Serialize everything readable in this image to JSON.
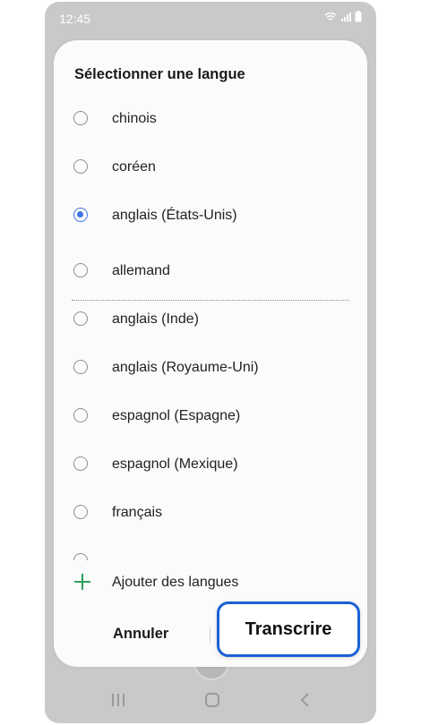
{
  "status_bar": {
    "time": "12:45"
  },
  "dialog": {
    "title": "Sélectionner une langue",
    "languages": [
      {
        "label": "chinois",
        "selected": false
      },
      {
        "label": "coréen",
        "selected": false
      },
      {
        "label": "anglais (États-Unis)",
        "selected": true
      },
      {
        "label": "allemand",
        "selected": false
      },
      {
        "label": "anglais (Inde)",
        "selected": false
      },
      {
        "label": "anglais (Royaume-Uni)",
        "selected": false
      },
      {
        "label": "espagnol (Espagne)",
        "selected": false
      },
      {
        "label": "espagnol (Mexique)",
        "selected": false
      },
      {
        "label": "français",
        "selected": false
      }
    ],
    "add_languages_label": "Ajouter des langues",
    "cancel_label": "Annuler",
    "transcribe_label": "Transcrire"
  },
  "icons": {
    "add": "plus-icon",
    "wifi": "wifi-icon",
    "signal": "signal-icon",
    "battery": "battery-icon"
  },
  "colors": {
    "accent": "#3e75e6",
    "highlight_border": "#1a62d6",
    "add_icon": "#2f9e5a"
  }
}
